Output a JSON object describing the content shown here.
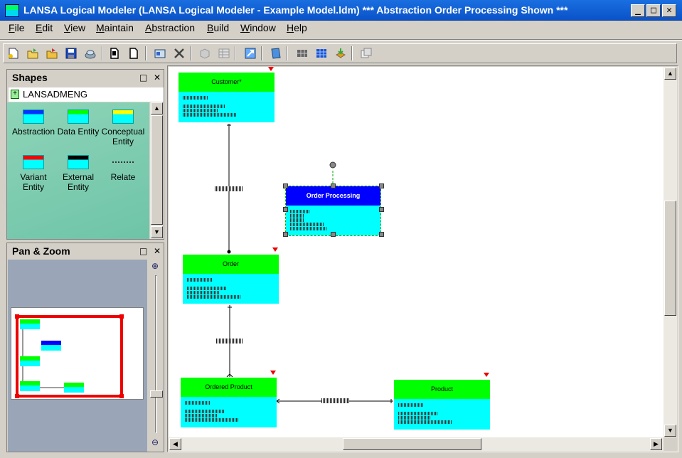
{
  "window": {
    "title": "LANSA Logical Modeler (LANSA Logical Modeler - Example Model.ldm) *** Abstraction Order Processing Shown ***",
    "minimize_glyph": "_",
    "maximize_glyph": "□",
    "close_glyph": "✕"
  },
  "menu": [
    "File",
    "Edit",
    "View",
    "Maintain",
    "Abstraction",
    "Build",
    "Window",
    "Help"
  ],
  "shapes_panel": {
    "title": "Shapes",
    "library": "LANSADMENG",
    "items": [
      {
        "label": "Abstraction",
        "head_color": "#0033ff"
      },
      {
        "label": "Data Entity",
        "head_color": "#00ff00"
      },
      {
        "label": "Conceptual Entity",
        "head_color": "#ffff00"
      },
      {
        "label": "Variant Entity",
        "head_color": "#ff0000"
      },
      {
        "label": "External Entity",
        "head_color": "#000000"
      },
      {
        "label": "Relate",
        "head_color": ""
      }
    ]
  },
  "panzoom_panel": {
    "title": "Pan & Zoom"
  },
  "entities": {
    "customer": {
      "name": "Customer*",
      "color": "#00ff00"
    },
    "order_processing": {
      "name": "Order Processing",
      "color": "#0000ff"
    },
    "order": {
      "name": "Order",
      "color": "#00ff00"
    },
    "ordered_product": {
      "name": "Ordered Product",
      "color": "#00ff00"
    },
    "product": {
      "name": "Product",
      "color": "#00ff00"
    }
  },
  "colors": {
    "entity_body": "#00ffff",
    "marker": "#ee0000",
    "selection": "#00aa00"
  }
}
